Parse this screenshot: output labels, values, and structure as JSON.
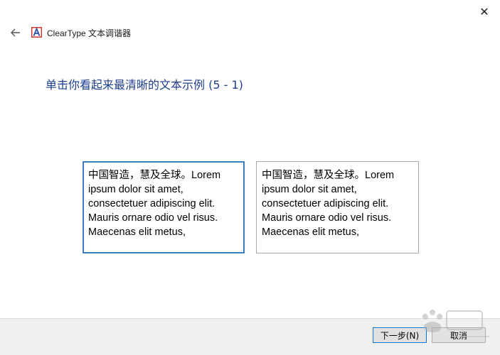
{
  "window": {
    "app_title": "ClearType 文本调谐器"
  },
  "page": {
    "instruction": "单击你看起来最清晰的文本示例 (5 - 1)"
  },
  "samples": [
    {
      "text": "中国智造，慧及全球。Lorem ipsum dolor sit amet, consectetuer adipiscing elit. Mauris ornare odio vel risus. Maecenas elit metus,",
      "selected": true
    },
    {
      "text": "中国智造，慧及全球。Lorem ipsum dolor sit amet, consectetuer adipiscing elit. Mauris ornare odio vel risus. Maecenas elit metus,",
      "selected": false
    }
  ],
  "footer": {
    "next_label": "下一步(N)",
    "cancel_label": "取消"
  },
  "icons": {
    "close": "close-icon",
    "back": "back-arrow-icon",
    "app": "cleartype-app-icon"
  },
  "colors": {
    "instruction_text": "#1e3e8e",
    "selected_border": "#3b7ebf",
    "footer_bg": "#f0f0f0"
  }
}
